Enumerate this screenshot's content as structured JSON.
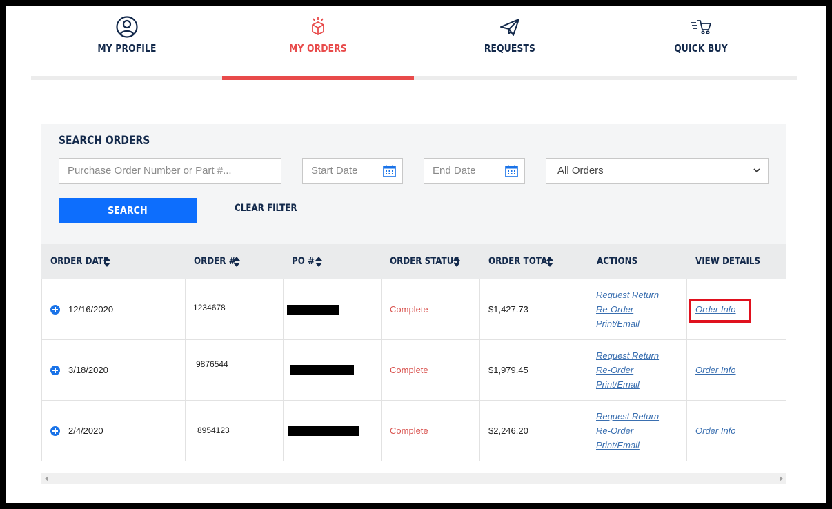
{
  "nav": {
    "items": [
      {
        "label": "MY PROFILE",
        "icon": "user-circle-icon"
      },
      {
        "label": "MY ORDERS",
        "icon": "box-icon",
        "active": true
      },
      {
        "label": "REQUESTS",
        "icon": "paper-plane-icon"
      },
      {
        "label": "QUICK BUY",
        "icon": "cart-icon"
      }
    ],
    "active_color": "#e84a4a",
    "text_color": "#13294b"
  },
  "search": {
    "title": "SEARCH ORDERS",
    "po_placeholder": "Purchase Order Number or Part #...",
    "start_placeholder": "Start Date",
    "end_placeholder": "End Date",
    "filter_selected": "All Orders",
    "search_label": "SEARCH",
    "clear_label": "CLEAR FILTER"
  },
  "table": {
    "headers": {
      "order_date": "ORDER DATE",
      "order_num": "ORDER #",
      "po_num": "PO #",
      "status": "ORDER STATUS",
      "total": "ORDER TOTAL",
      "actions": "ACTIONS",
      "details": "VIEW DETAILS"
    },
    "rows": [
      {
        "date": "12/16/2020",
        "order": "1234678",
        "status": "Complete",
        "total": "$1,427.73",
        "return": "Request Return",
        "reorder": "Re-Order",
        "print": "Print/Email",
        "info": "Order Info"
      },
      {
        "date": "3/18/2020",
        "order": "9876544",
        "status": "Complete",
        "total": "$1,979.45",
        "return": "Request Return",
        "reorder": "Re-Order",
        "print": "Print/Email",
        "info": "Order Info"
      },
      {
        "date": "2/4/2020",
        "order": "8954123",
        "status": "Complete",
        "total": "$2,246.20",
        "return": "Request Return",
        "reorder": "Re-Order",
        "print": "Print/Email",
        "info": "Order Info"
      }
    ]
  },
  "colors": {
    "primary_button": "#0d6efd",
    "status_complete": "#d9534f",
    "link": "#3a6fb0",
    "highlight": "#e0111e"
  }
}
